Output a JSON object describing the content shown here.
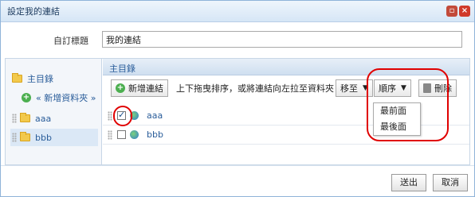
{
  "dialog": {
    "title": "設定我的連結"
  },
  "form": {
    "label": "自訂標題",
    "value": "我的連結"
  },
  "sidebar": {
    "root": "主目錄",
    "add_folder": "« 新增資料夾 »",
    "folders": [
      "aaa",
      "bbb"
    ]
  },
  "main": {
    "header": "主目錄",
    "add_link": "新增連結",
    "hint": "上下拖曳排序，或將連結向左拉至資料夾",
    "move_to": "移至",
    "order": "順序",
    "delete": "刪除",
    "order_options": [
      "最前面",
      "最後面"
    ],
    "links": [
      {
        "label": "aaa",
        "checked": true
      },
      {
        "label": "bbb",
        "checked": false
      }
    ]
  },
  "footer": {
    "submit": "送出",
    "cancel": "取消"
  }
}
